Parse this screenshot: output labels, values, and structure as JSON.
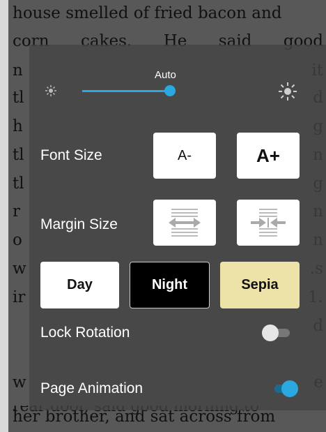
{
  "book": {
    "line1": "house smelled of fried bacon and",
    "line2_words": [
      "corn",
      "cakes.",
      "He",
      "said",
      "good"
    ],
    "partial_left": [
      "n",
      "tl",
      "h",
      "tl",
      "tl",
      "r",
      "o",
      "w",
      "ir",
      "",
      "w"
    ],
    "partial_right": [
      "it",
      "d",
      "g",
      "n",
      "g",
      "n",
      "n",
      ".s",
      "1.",
      "d",
      "e"
    ],
    "line_bottom1": "rear door, said good morning to",
    "line_bottom2": "her brother, and sat across from"
  },
  "settings": {
    "brightness": {
      "auto_label": "Auto",
      "level": 0.95,
      "dim_icon": "sun-dim-icon",
      "bright_icon": "sun-bright-icon"
    },
    "font_size": {
      "label": "Font Size",
      "decrease": "A-",
      "increase": "A+"
    },
    "margin_size": {
      "label": "Margin Size",
      "widen_icon": "margin-widen-icon",
      "narrow_icon": "margin-narrow-icon"
    },
    "modes": {
      "day": "Day",
      "night": "Night",
      "sepia": "Sepia",
      "selected": "night"
    },
    "lock_rotation": {
      "label": "Lock Rotation",
      "enabled": false
    },
    "page_animation": {
      "label": "Page Animation",
      "enabled": true
    },
    "colors": {
      "accent": "#29a9e0",
      "sepia": "#ede3a8",
      "night": "#000000",
      "day": "#ffffff"
    }
  }
}
